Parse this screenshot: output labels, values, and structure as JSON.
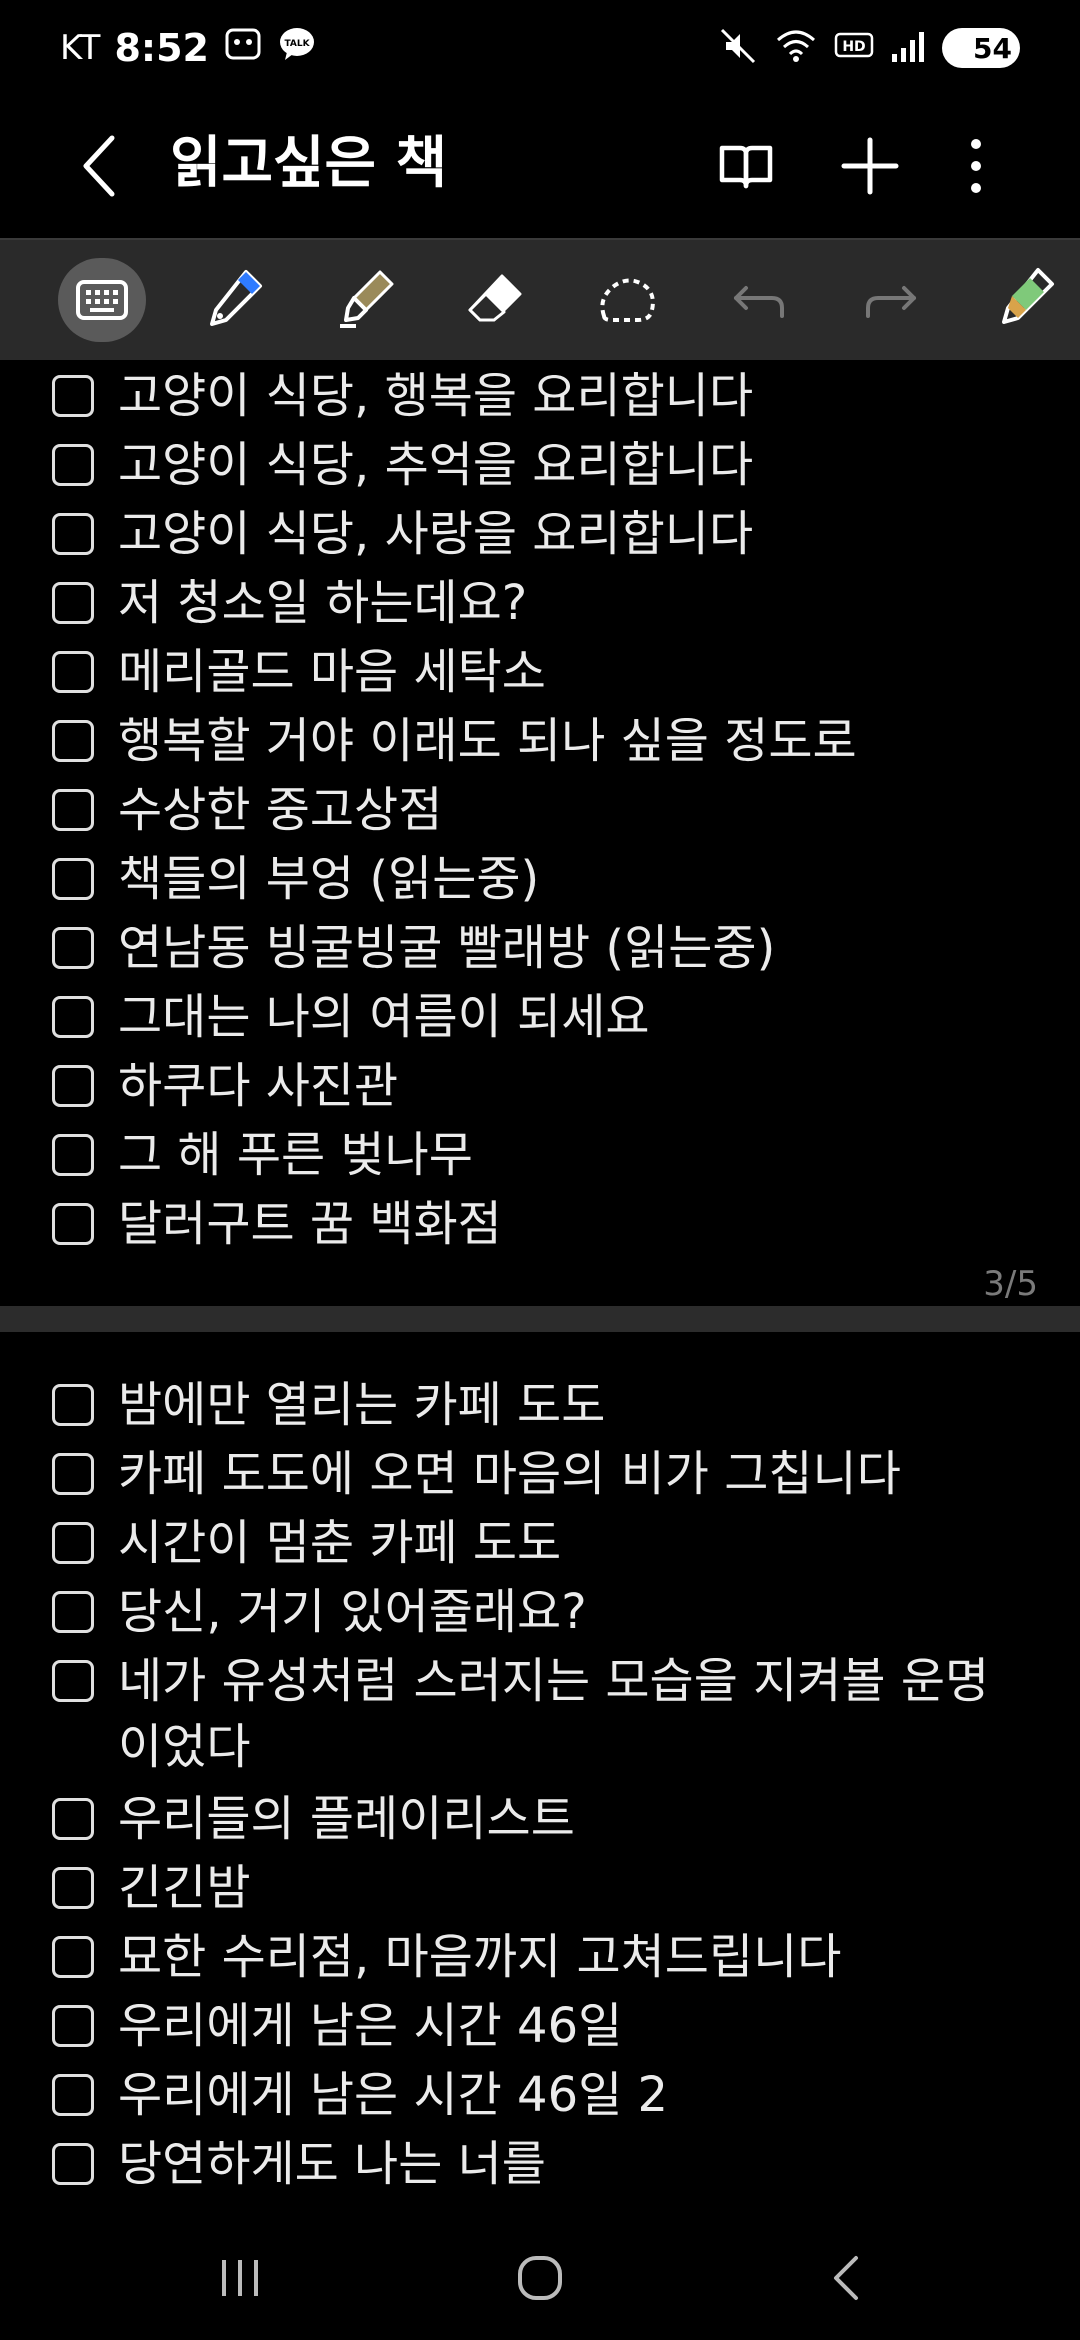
{
  "status_bar": {
    "carrier": "KT",
    "time": "8:52",
    "battery": "54"
  },
  "app_bar": {
    "title": "읽고싶은 책"
  },
  "toolbar": {
    "tools": [
      "keyboard-icon",
      "pen-icon",
      "highlighter-icon",
      "eraser-icon",
      "lasso-icon",
      "undo-icon",
      "redo-icon",
      "pen-settings-icon"
    ]
  },
  "page1": {
    "items": [
      "고양이 식당, 행복을 요리합니다",
      "고양이 식당, 추억을 요리합니다",
      "고양이 식당, 사랑을 요리합니다",
      "저 청소일 하는데요?",
      "메리골드 마음 세탁소",
      "행복할 거야 이래도 되나 싶을 정도로",
      "수상한 중고상점",
      "책들의 부엉 (읽는중)",
      "연남동 빙굴빙굴 빨래방 (읽는중)",
      "그대는 나의 여름이 되세요",
      "하쿠다 사진관",
      "그 해 푸른 벚나무",
      "달러구트 꿈 백화점"
    ],
    "page_number": "3/5"
  },
  "page2": {
    "items": [
      "밤에만 열리는 카페 도도",
      "카페 도도에 오면 마음의 비가 그칩니다",
      "시간이 멈춘 카페 도도",
      "당신, 거기 있어줄래요?",
      "네가 유성처럼 스러지는 모습을 지켜볼 운명이었다",
      "우리들의 플레이리스트",
      "긴긴밤",
      "묘한 수리점, 마음까지 고쳐드립니다",
      "우리에게 남은 시간 46일",
      "우리에게 남은 시간 46일 2",
      "당연하게도 나는 너를"
    ]
  },
  "nav_bar": {
    "buttons": [
      "recent-apps-icon",
      "home-icon",
      "back-icon"
    ]
  }
}
